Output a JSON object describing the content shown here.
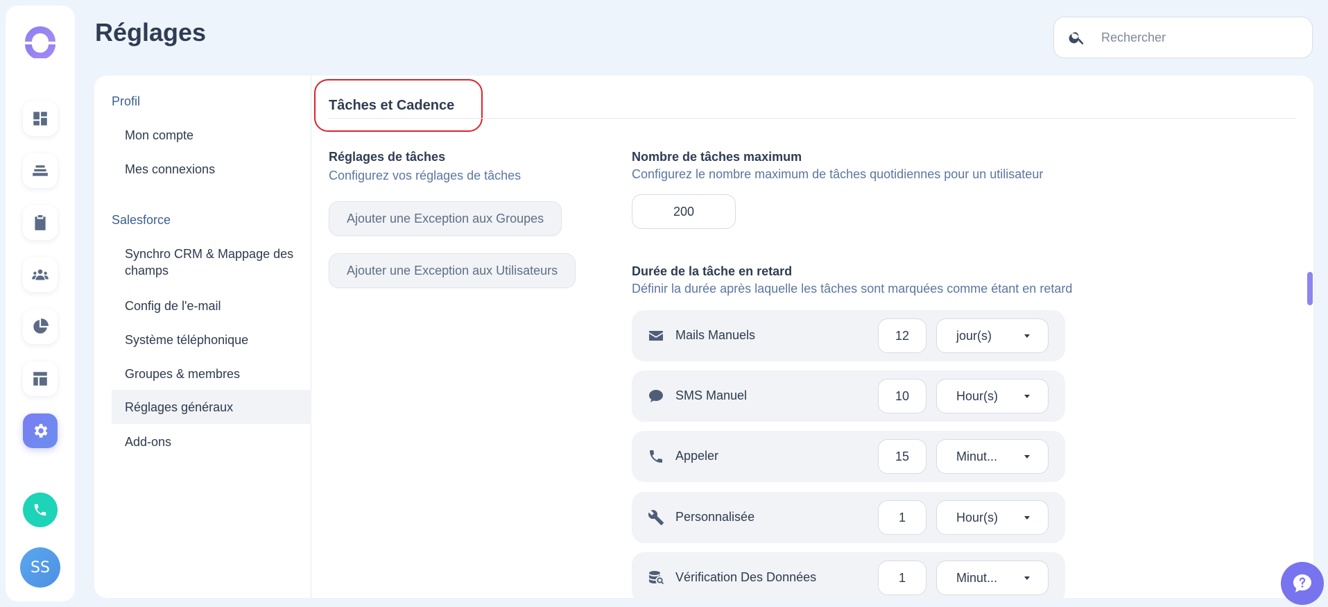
{
  "header": {
    "title": "Réglages",
    "search_placeholder": "Rechercher"
  },
  "rail": {
    "items": [
      {
        "name": "dashboard-icon"
      },
      {
        "name": "layers-icon"
      },
      {
        "name": "clipboard-icon"
      },
      {
        "name": "people-icon"
      },
      {
        "name": "pie-chart-icon"
      },
      {
        "name": "layout-icon"
      },
      {
        "name": "gear-icon",
        "active": true
      }
    ],
    "avatar_initials": "SS"
  },
  "subnav": {
    "groups": [
      {
        "label": "Profil",
        "items": [
          "Mon compte",
          "Mes connexions"
        ]
      },
      {
        "label": "Salesforce",
        "items": [
          "Synchro CRM & Mappage des champs",
          "Config de l'e-mail",
          "Système téléphonique",
          "Groupes & membres",
          "Réglages généraux",
          "Add-ons"
        ]
      }
    ],
    "active_item": "Réglages généraux"
  },
  "section": {
    "title": "Tâches et Cadence"
  },
  "task_settings": {
    "title": "Réglages de tâches",
    "subtitle": "Configurez vos réglages de tâches",
    "btn_groups": "Ajouter une Exception aux Groupes",
    "btn_users": "Ajouter une Exception aux Utilisateurs"
  },
  "max_tasks": {
    "title": "Nombre de tâches maximum",
    "subtitle": "Configurez le nombre maximum de tâches quotidiennes pour un utilisateur",
    "value": "200"
  },
  "late_duration": {
    "title": "Durée de la tâche en retard",
    "subtitle": "Définir la durée après laquelle les tâches sont marquées comme étant en retard",
    "rows": [
      {
        "icon": "mail-icon",
        "label": "Mails Manuels",
        "value": "12",
        "unit": "jour(s)"
      },
      {
        "icon": "chat-icon",
        "label": "SMS Manuel",
        "value": "10",
        "unit": "Hour(s)"
      },
      {
        "icon": "phone-icon",
        "label": "Appeler",
        "value": "15",
        "unit": "Minut..."
      },
      {
        "icon": "wrench-icon",
        "label": "Personnalisée",
        "value": "1",
        "unit": "Hour(s)"
      },
      {
        "icon": "data-check-icon",
        "label": "Vérification Des Données",
        "value": "1",
        "unit": "Minut..."
      }
    ]
  }
}
